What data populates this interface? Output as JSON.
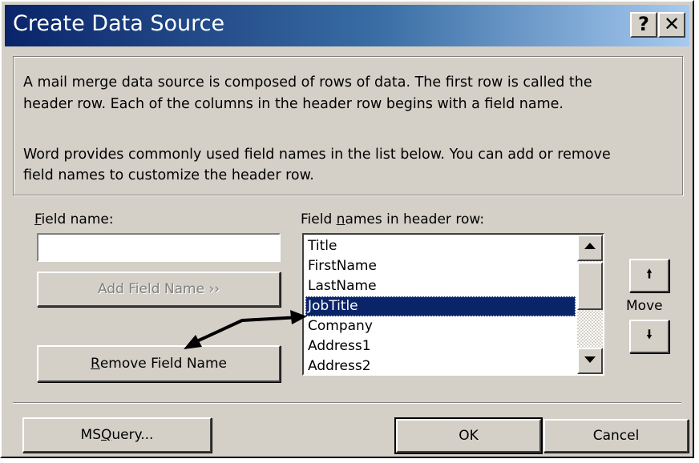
{
  "window": {
    "title": "Create Data Source",
    "help_button": "?",
    "close_button": "✕"
  },
  "description": {
    "line1": "A mail merge data source is composed of rows of data. The first row is called the",
    "line2": "header row. Each of the columns in the header row begins with a field name.",
    "line3": "Word provides commonly used field names in the list below. You can add or remove",
    "line4": "field names to customize the header row."
  },
  "field_name": {
    "label_access_key": "F",
    "label_rest": "ield name:",
    "value": ""
  },
  "buttons": {
    "add_field_name": "Add Field Name  ››",
    "remove_access_key": "R",
    "remove_rest": "emove Field Name",
    "ms_query_prefix": "MS ",
    "ms_query_access_key": "Q",
    "ms_query_rest": "uery...",
    "ok": "OK",
    "cancel": "Cancel",
    "move_up_icon": "arrow-up-icon",
    "move_down_icon": "arrow-down-icon"
  },
  "header_list": {
    "label_prefix": "Field ",
    "label_access_key": "n",
    "label_rest": "ames in header row:",
    "items": [
      "Title",
      "FirstName",
      "LastName",
      "JobTitle",
      "Company",
      "Address1",
      "Address2"
    ],
    "selected": "JobTitle"
  },
  "move_label": "Move",
  "colors": {
    "dialog_face": "#d4d0c8",
    "title_bar_start": "#0a246a",
    "title_bar_end": "#a6caf0",
    "selection": "#0a246a"
  }
}
